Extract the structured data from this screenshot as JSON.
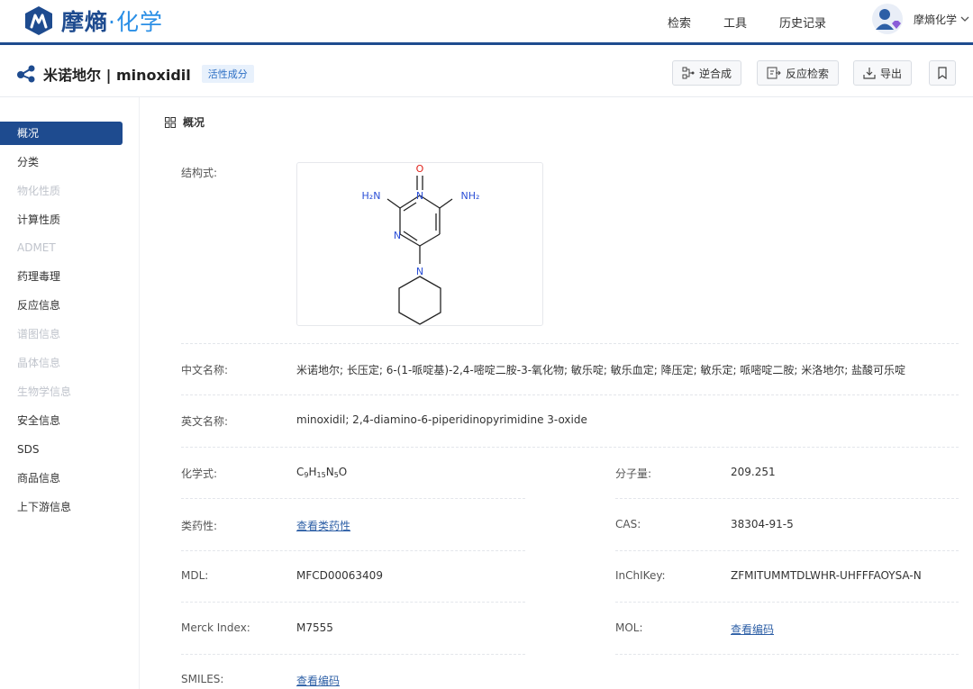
{
  "app": {
    "logo_text_a": "摩熵",
    "logo_text_b": "·化学",
    "nav": [
      "检索",
      "工具",
      "历史记录"
    ],
    "user_name": "摩熵化学",
    "brand_color": "#1e4b8f"
  },
  "compound": {
    "title": "米诺地尔 | minoxidil",
    "tag": "活性成分",
    "buttons": {
      "retro": "逆合成",
      "reaction_search": "反应检索",
      "export": "导出"
    }
  },
  "sidebar": {
    "items": [
      {
        "label": "概况",
        "state": "active"
      },
      {
        "label": "分类",
        "state": "normal"
      },
      {
        "label": "物化性质",
        "state": "disabled"
      },
      {
        "label": "计算性质",
        "state": "normal"
      },
      {
        "label": "ADMET",
        "state": "disabled"
      },
      {
        "label": "药理毒理",
        "state": "normal"
      },
      {
        "label": "反应信息",
        "state": "normal"
      },
      {
        "label": "谱图信息",
        "state": "disabled"
      },
      {
        "label": "晶体信息",
        "state": "disabled"
      },
      {
        "label": "生物学信息",
        "state": "disabled"
      },
      {
        "label": "安全信息",
        "state": "normal"
      },
      {
        "label": "SDS",
        "state": "normal"
      },
      {
        "label": "商品信息",
        "state": "normal"
      },
      {
        "label": "上下游信息",
        "state": "normal"
      }
    ]
  },
  "overview": {
    "section_title": "概况",
    "structure_label": "结构式:",
    "structure_atoms": {
      "o": "O",
      "n_top": "N",
      "n_left": "N",
      "n_pip": "N",
      "nh2_left": "H₂N",
      "nh2_right": "NH₂"
    },
    "cn_name_label": "中文名称:",
    "cn_name": "米诺地尔; 长压定; 6-(1-哌啶基)-2,4-嘧啶二胺-3-氧化物; 敏乐啶; 敏乐血定; 降压定; 敏乐定; 哌嘧啶二胺; 米洛地尔; 盐酸可乐啶",
    "en_name_label": "英文名称:",
    "en_name": "minoxidil; 2,4-diamino-6-piperidinopyrimidine 3-oxide",
    "formula_label": "化学式:",
    "formula": {
      "C": "C",
      "c_n": "9",
      "H": "H",
      "h_n": "15",
      "N": "N",
      "n_n": "5",
      "O": "O"
    },
    "mw_label": "分子量:",
    "mw": "209.251",
    "druglike_label": "类药性:",
    "druglike_link": "查看类药性",
    "cas_label": "CAS:",
    "cas": "38304-91-5",
    "mdl_label": "MDL:",
    "mdl": "MFCD00063409",
    "inchikey_label": "InChIKey:",
    "inchikey": "ZFMITUMMTDLWHR-UHFFFAOYSA-N",
    "merck_label": "Merck Index:",
    "merck": "M7555",
    "mol_label": "MOL:",
    "mol_link": "查看编码",
    "smiles_label": "SMILES:",
    "smiles_link": "查看编码"
  }
}
